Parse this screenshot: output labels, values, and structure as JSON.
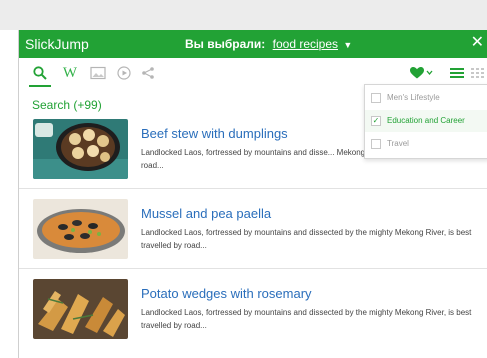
{
  "app": {
    "brand": "SlickJump",
    "selection_prefix": "Вы выбрали:",
    "selected_topic": "food recipes",
    "accent_color": "#22a235",
    "link_color": "#2a6ebb"
  },
  "toolbar": {
    "left_icons": [
      "search-icon",
      "wikipedia-icon",
      "image-icon",
      "video-icon",
      "share-icon"
    ],
    "wikipedia_glyph": "W",
    "right_icons": [
      "heart-icon",
      "list-view-icon",
      "grid-view-icon"
    ]
  },
  "search": {
    "count_label": "Search (+99)"
  },
  "results": [
    {
      "title": "Beef stew with dumplings",
      "description": "Landlocked Laos, fortressed by mountains and disse... Mekong River, is best travelled by road..."
    },
    {
      "title": "Mussel and pea paella",
      "description": "Landlocked Laos, fortressed by mountains and dissected by the mighty Mekong River, is best travelled by road..."
    },
    {
      "title": "Potato wedges with rosemary",
      "description": "Landlocked Laos, fortressed by mountains and dissected by the mighty Mekong River, is best travelled by road..."
    }
  ],
  "dropdown": {
    "items": [
      {
        "label": "Men's Lifestyle",
        "checked": false
      },
      {
        "label": "Education and Career",
        "checked": true
      },
      {
        "label": "Travel",
        "checked": false
      }
    ]
  }
}
